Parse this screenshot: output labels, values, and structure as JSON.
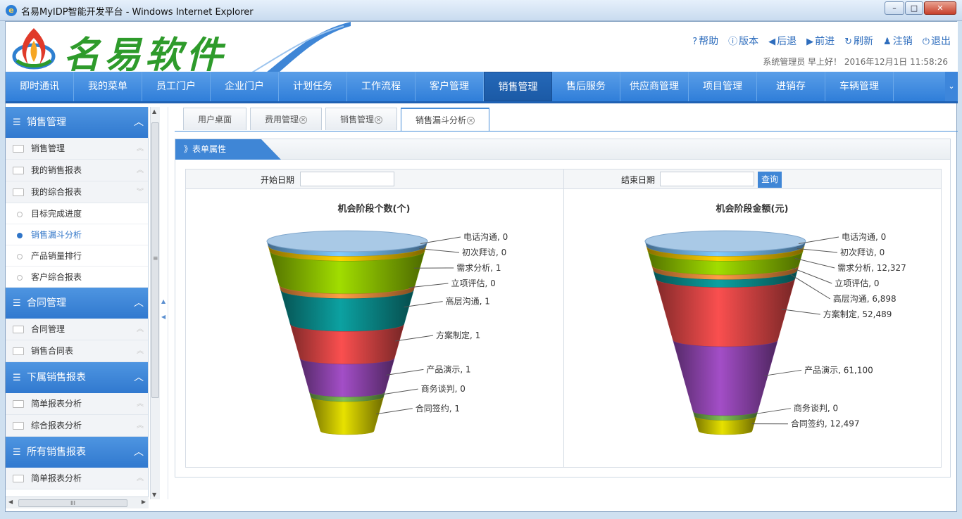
{
  "window": {
    "title": "名易MyIDP智能开发平台 - Windows Internet Explorer"
  },
  "header": {
    "logo_text": "名易软件",
    "links": [
      {
        "icon": "help-icon",
        "glyph": "?",
        "label": "帮助"
      },
      {
        "icon": "info-icon",
        "glyph": "ⓘ",
        "label": "版本"
      },
      {
        "icon": "back-icon",
        "glyph": "◀",
        "label": "后退"
      },
      {
        "icon": "forward-icon",
        "glyph": "▶",
        "label": "前进"
      },
      {
        "icon": "refresh-icon",
        "glyph": "↻",
        "label": "刷新"
      },
      {
        "icon": "user-icon",
        "glyph": "♟",
        "label": "注销"
      },
      {
        "icon": "power-icon",
        "glyph": "⏻",
        "label": "退出"
      }
    ],
    "user_line": "系统管理员 早上好！ 2016年12月1日 11:58:26"
  },
  "nav": {
    "items": [
      "即时通讯",
      "我的菜单",
      "员工门户",
      "企业门户",
      "计划任务",
      "工作流程",
      "客户管理",
      "销售管理",
      "售后服务",
      "供应商管理",
      "项目管理",
      "进销存",
      "车辆管理"
    ],
    "active": "销售管理"
  },
  "sidebar": {
    "groups": [
      {
        "label": "销售管理",
        "items": [
          "销售管理",
          "我的销售报表",
          "我的综合报表"
        ],
        "subs": [
          "目标完成进度",
          "销售漏斗分析",
          "产品销量排行",
          "客户综合报表"
        ]
      },
      {
        "label": "合同管理",
        "items": [
          "合同管理",
          "销售合同表"
        ],
        "subs": []
      },
      {
        "label": "下属销售报表",
        "items": [
          "简单报表分析",
          "综合报表分析"
        ],
        "subs": []
      },
      {
        "label": "所有销售报表",
        "items": [
          "简单报表分析"
        ],
        "subs": []
      }
    ],
    "selected": "销售漏斗分析"
  },
  "tabs": [
    {
      "label": "用户桌面",
      "closable": false
    },
    {
      "label": "费用管理",
      "closable": true
    },
    {
      "label": "销售管理",
      "closable": true
    },
    {
      "label": "销售漏斗分析",
      "closable": true,
      "active": true
    }
  ],
  "panel": {
    "title": "》表单属性",
    "start_label": "开始日期",
    "end_label": "结束日期",
    "start_value": "",
    "end_value": "",
    "query_label": "查询"
  },
  "chart_data": [
    {
      "type": "funnel",
      "title": "机会阶段个数(个)",
      "categories": [
        "电话沟通",
        "初次拜访",
        "需求分析",
        "立项评估",
        "高层沟通",
        "方案制定",
        "产品演示",
        "商务谈判",
        "合同签约"
      ],
      "values": [
        0,
        0,
        1,
        0,
        1,
        1,
        1,
        0,
        1
      ],
      "value_labels": [
        "0",
        "0",
        "1",
        "0",
        "1",
        "1",
        "1",
        "0",
        "1"
      ]
    },
    {
      "type": "funnel",
      "title": "机会阶段金额(元)",
      "categories": [
        "电话沟通",
        "初次拜访",
        "需求分析",
        "立项评估",
        "高层沟通",
        "方案制定",
        "产品演示",
        "商务谈判",
        "合同签约"
      ],
      "values": [
        0,
        0,
        12327,
        0,
        6898,
        52489,
        61100,
        0,
        12497
      ],
      "value_labels": [
        "0",
        "0",
        "12,327",
        "0",
        "6,898",
        "52,489",
        "61,100",
        "0",
        "12,497"
      ]
    }
  ],
  "colors": [
    "#6fb1e8",
    "#e6b800",
    "#8cc000",
    "#f08a3c",
    "#0a8c8c",
    "#d94545",
    "#8e44ad",
    "#6fa84a",
    "#c9c400"
  ]
}
